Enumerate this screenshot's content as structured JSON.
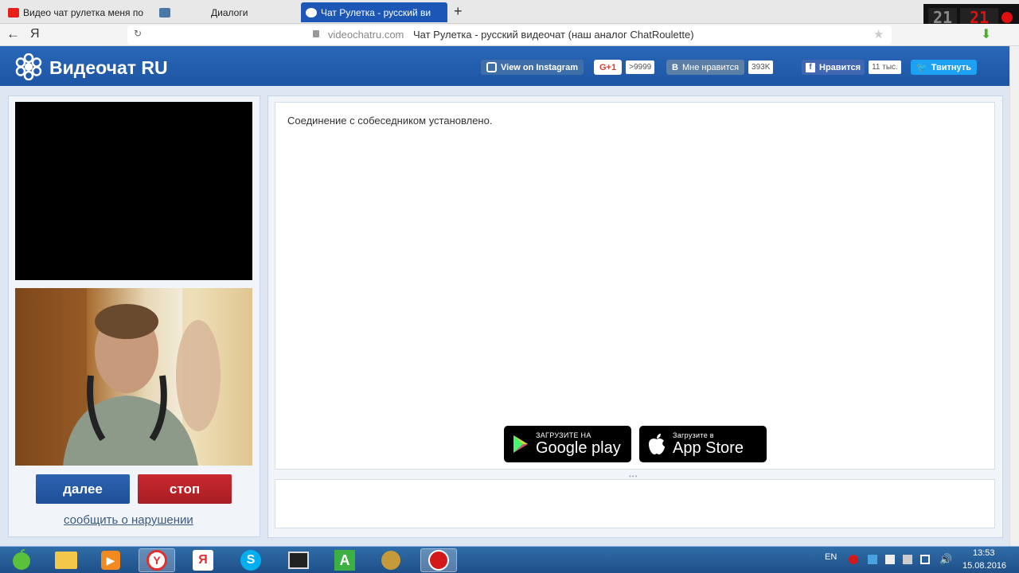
{
  "browser": {
    "tabs": [
      {
        "label": "Видео чат рулетка меня по",
        "active": false,
        "icon": "youtube-icon"
      },
      {
        "label": "Диалоги",
        "active": false,
        "icon": "vk-icon"
      },
      {
        "label": "Чат Рулетка - русский ви",
        "active": true,
        "icon": "site-logo-icon"
      }
    ],
    "new_tab": "+",
    "url": "videochatru.com",
    "page_title": "Чат Рулетка - русский видеочат (наш аналог ChatRoulette)",
    "ya_button": "Я",
    "rec_widget": {
      "left": "21",
      "right": "21"
    }
  },
  "site": {
    "logo": "Видеочат RU",
    "social": {
      "instagram": "View on Instagram",
      "gplus": "G+1",
      "gplus_count": ">9999",
      "vk_letter": "B",
      "vk_like": "Мне нравится",
      "vk_count": "393K",
      "fb_like": "Нравится",
      "fb_count": "11 тыс.",
      "twitter": "Твитнуть"
    },
    "controls": {
      "next": "далее",
      "stop": "стоп",
      "report": "сообщить о нарушении"
    },
    "chat": {
      "message": "Соединение с собеседником установлено.",
      "input_value": ""
    },
    "stores": {
      "google_small": "ЗАГРУЗИТЕ НА",
      "google_big": "Google play",
      "apple_small": "Загрузите в",
      "apple_big": "App Store"
    }
  },
  "taskbar": {
    "lang": "EN",
    "time": "13:53",
    "date": "15.08.2016"
  }
}
